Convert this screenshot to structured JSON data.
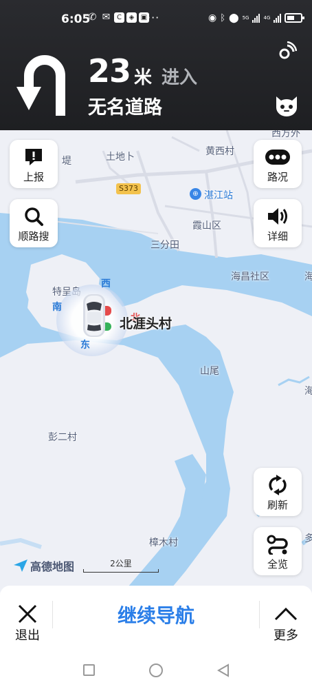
{
  "status_bar": {
    "time": "6:05",
    "dots": "···",
    "network_5g": "5G",
    "network_4g": "4G"
  },
  "navigation": {
    "maneuver_icon": "u-turn-left-arrow",
    "distance_value": "23",
    "distance_unit": "米",
    "action": "进入",
    "road_name": "无名道路"
  },
  "map": {
    "labels": {
      "xifangwai": "西方外",
      "ti": "堤",
      "tudi": "土地卜",
      "huangxicun": "黄西村",
      "road_s373": "S373",
      "zhanjiang_station": "湛江站",
      "xiashan_district": "霞山区",
      "sanfentian": "三分田",
      "haichang_community": "海昌社区",
      "hai_east": "海",
      "techengdao": "特呈岛",
      "beiyatoucun": "北涯头村",
      "shanwei": "山尾",
      "hai_east2": "海",
      "penger_village": "彭二村",
      "zhangmucun": "樟木村",
      "duo": "多"
    },
    "compass": {
      "west": "西",
      "south": "南",
      "east": "东",
      "north": "北"
    },
    "brand": "高德地图",
    "scale": "2公里"
  },
  "side_buttons": {
    "report": "上报",
    "along_search": "顺路搜",
    "traffic": "路况",
    "detail": "详细",
    "refresh": "刷新",
    "overview": "全览"
  },
  "bottom_bar": {
    "exit": "退出",
    "continue": "继续导航",
    "more": "更多"
  },
  "colors": {
    "header_bg": "#1e1f22",
    "water": "#a7d1f2",
    "land": "#eef0f6",
    "accent_blue": "#2a7ee8"
  }
}
